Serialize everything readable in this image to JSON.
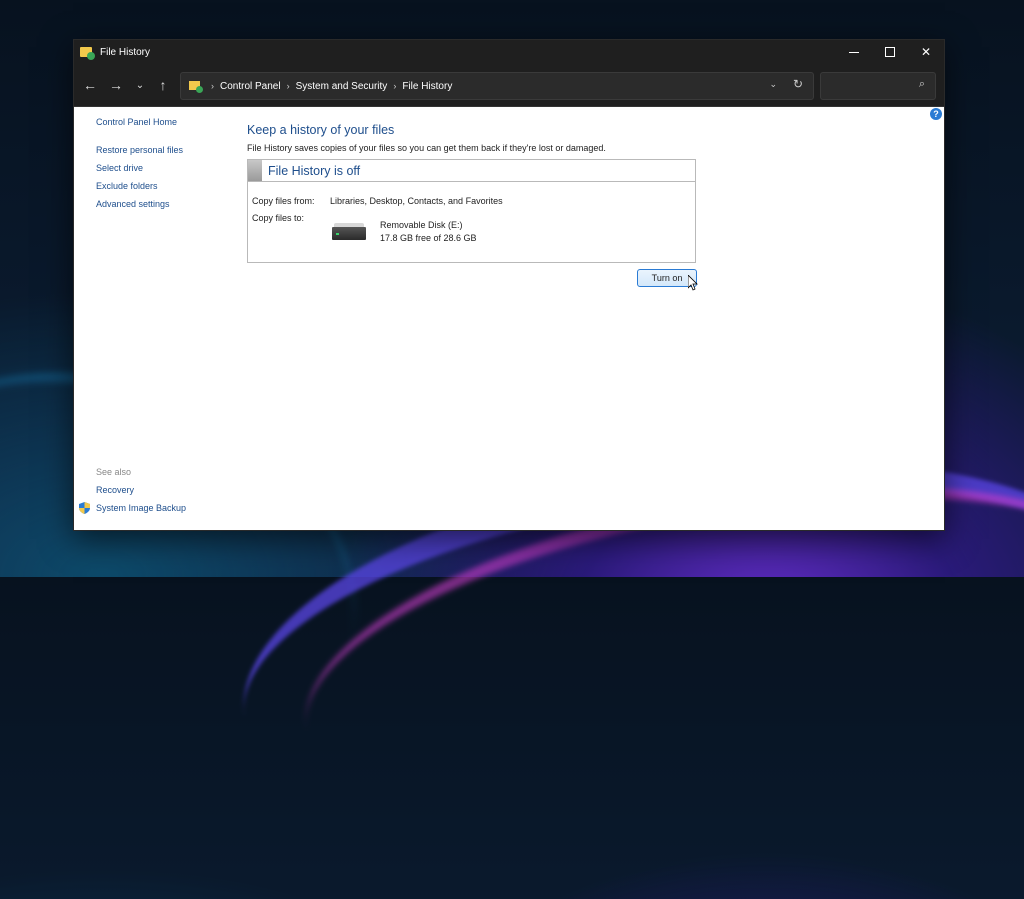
{
  "window": {
    "title": "File History"
  },
  "navbar": {
    "breadcrumbs": [
      "Control Panel",
      "System and Security",
      "File History"
    ],
    "search_placeholder": ""
  },
  "sidebar": {
    "home": "Control Panel Home",
    "items": [
      "Restore personal files",
      "Select drive",
      "Exclude folders",
      "Advanced settings"
    ],
    "see_also_label": "See also",
    "see_also": [
      "Recovery",
      "System Image Backup"
    ]
  },
  "main": {
    "title": "Keep a history of your files",
    "description": "File History saves copies of your files so you can get them back if they're lost or damaged.",
    "status": "File History is off",
    "copy_from_label": "Copy files from:",
    "copy_from_value": "Libraries, Desktop, Contacts, and Favorites",
    "copy_to_label": "Copy files to:",
    "drive_name": "Removable Disk (E:)",
    "drive_space": "17.8 GB free of 28.6 GB",
    "turn_on_label": "Turn on"
  },
  "colors": {
    "link": "#1e4e8c",
    "titlebar": "#1f1f1f",
    "accent": "#2a7bd4"
  }
}
